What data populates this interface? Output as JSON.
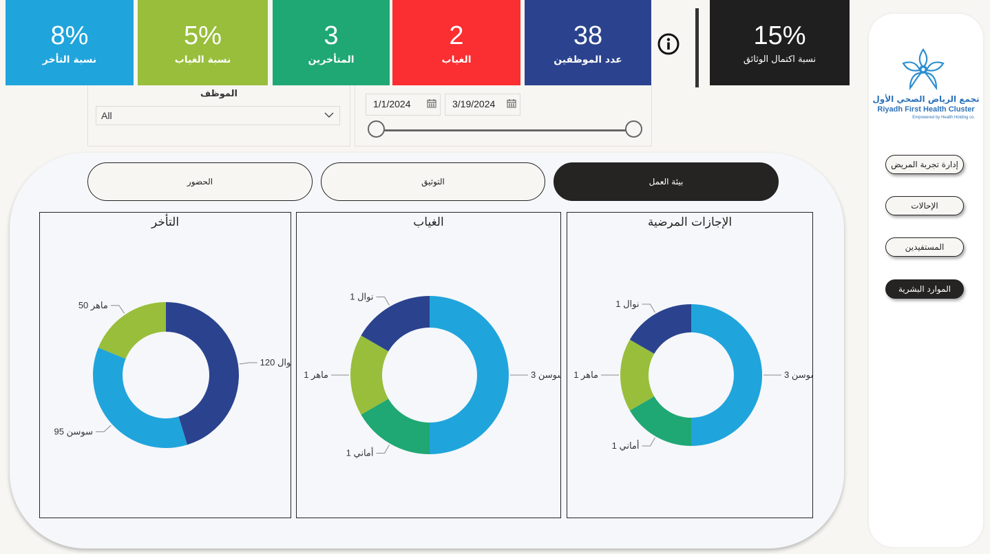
{
  "kpis": [
    {
      "value": "8%",
      "label": "نسبة التأخر",
      "color": "#20a4dc"
    },
    {
      "value": "5%",
      "label": "نسبة الغياب",
      "color": "#98be3b"
    },
    {
      "value": "3",
      "label": "المتأخرين",
      "color": "#1fa774"
    },
    {
      "value": "2",
      "label": "الغياب",
      "color": "#fb2e31"
    },
    {
      "value": "38",
      "label": "عدد الموظفين",
      "color": "#2b438e"
    },
    {
      "value": "15%",
      "label": "نسبة اكتمال الوثائق",
      "color": "#1f1f1f"
    }
  ],
  "filters": {
    "employee_title": "الموظف",
    "employee_value": "All",
    "date_start": "1/1/2024",
    "date_end": "3/19/2024"
  },
  "sidebar": {
    "logo_ar": "تجمع الرياض الصحي الأول",
    "logo_en": "Riyadh First Health Cluster",
    "logo_sub": "Empowered by Health Holding co.",
    "items": [
      {
        "label": "إدارة تجربة المريض",
        "active": false
      },
      {
        "label": "الإحالات",
        "active": false
      },
      {
        "label": "المستفيدين",
        "active": false
      },
      {
        "label": "الموارد البشرية",
        "active": true
      }
    ]
  },
  "tabs": [
    {
      "label": "الحضور",
      "active": false
    },
    {
      "label": "التوثيق",
      "active": false
    },
    {
      "label": "بيئة العمل",
      "active": true
    }
  ],
  "chart_data": [
    {
      "type": "pie",
      "title": "التأخر",
      "donut": true,
      "categories": [
        "نوال",
        "سوسن",
        "ماهر"
      ],
      "values": [
        120,
        95,
        50
      ],
      "colors": [
        "#2b438e",
        "#20a4dc",
        "#98be3b"
      ]
    },
    {
      "type": "pie",
      "title": "الغياب",
      "donut": true,
      "categories": [
        "سوسن",
        "أماني",
        "ماهر",
        "نوال"
      ],
      "values": [
        3,
        1,
        1,
        1
      ],
      "colors": [
        "#20a4dc",
        "#1fa774",
        "#98be3b",
        "#2b438e"
      ]
    },
    {
      "type": "pie",
      "title": "الإجازات المرضية",
      "donut": true,
      "categories": [
        "سوسن",
        "أماني",
        "ماهر",
        "نوال"
      ],
      "values": [
        3,
        1,
        1,
        1
      ],
      "colors": [
        "#20a4dc",
        "#1fa774",
        "#98be3b",
        "#2b438e"
      ]
    }
  ]
}
